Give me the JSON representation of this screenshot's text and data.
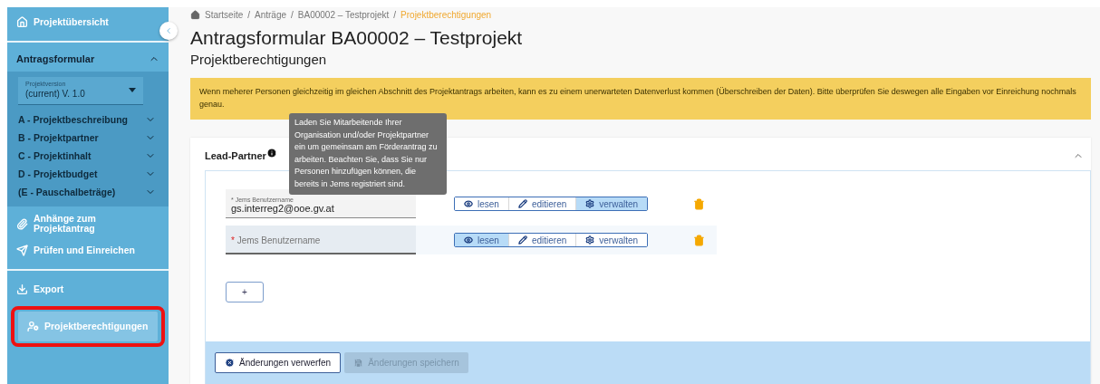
{
  "sidebar": {
    "top": {
      "kind": "home",
      "label": "Projektübersicht",
      "selected": false
    },
    "section": {
      "label": "Antragsformular",
      "expanded": true,
      "version": {
        "label": "Projektversion",
        "value": "(current) V. 1.0"
      },
      "items": [
        {
          "label": "A - Projektbeschreibung",
          "expanded": false
        },
        {
          "label": "B - Projektpartner",
          "expanded": false
        },
        {
          "label": "C - Projektinhalt",
          "expanded": false
        },
        {
          "label": "D - Projektbudget",
          "expanded": false
        },
        {
          "label": "(E - Pauschalbeträge)",
          "expanded": false
        }
      ]
    },
    "links": [
      {
        "kind": "attachment",
        "label": "Anhänge zum Projektantrag",
        "selected": false
      },
      {
        "kind": "send",
        "label": "Prüfen und Einreichen",
        "selected": false
      }
    ],
    "bottom_links": [
      {
        "kind": "download",
        "label": "Export",
        "selected": false
      },
      {
        "kind": "permissions",
        "label": "Projektberechtigungen",
        "selected": true,
        "highlighted": true
      }
    ]
  },
  "breadcrumb": [
    {
      "label": "Startseite",
      "current": false
    },
    {
      "separator": "/",
      "label": "Anträge",
      "current": false
    },
    {
      "separator": "/",
      "label": "BA00002 – Testprojekt",
      "current": false
    },
    {
      "separator": "/",
      "label": "Projektberechtigungen",
      "current": true
    }
  ],
  "title": "Antragsformular BA00002 – Testprojekt",
  "subtitle": "Projektberechtigungen",
  "warning": "Wenn meherer Personen gleichzeitig im gleichen Abschnitt des Projektantrags arbeiten, kann es zu einem unerwarteten Datenverlust kommen (Überschreiben der Daten). Bitte überprüfen Sie deswegen alle Eingaben vor Einreichung nochmals genau.",
  "card": {
    "title": "Lead-Partner",
    "expanded": true,
    "tooltip": "Laden Sie Mitarbeitende Ihrer Organisation und/oder Projektpartner ein um gemeinsam am Förderantrag zu arbeiten. Beachten Sie, dass Sie nur Personen hinzufügen können, die bereits in Jems registriert sind.",
    "rows": [
      {
        "field": {
          "required_mark": "*",
          "label": "Jems Benutzername",
          "value": "gs.interreg2@ooe.gv.at",
          "focused": false
        },
        "permissions": [
          {
            "kind": "read",
            "label": "lesen",
            "selected": false
          },
          {
            "kind": "edit",
            "label": "editieren",
            "selected": false
          },
          {
            "kind": "manage",
            "label": "verwalten",
            "selected": true
          }
        ]
      },
      {
        "field": {
          "required_mark": "*",
          "placeholder": "Jems Benutzername",
          "focused": true
        },
        "permissions": [
          {
            "kind": "read",
            "label": "lesen",
            "selected": true
          },
          {
            "kind": "edit",
            "label": "editieren",
            "selected": false
          },
          {
            "kind": "manage",
            "label": "verwalten",
            "selected": false
          }
        ]
      }
    ],
    "add_button": "+",
    "actions": [
      {
        "kind": "discard",
        "label": "Änderungen verwerfen",
        "disabled": false
      },
      {
        "kind": "save",
        "label": "Änderungen speichern",
        "disabled": true
      }
    ]
  }
}
